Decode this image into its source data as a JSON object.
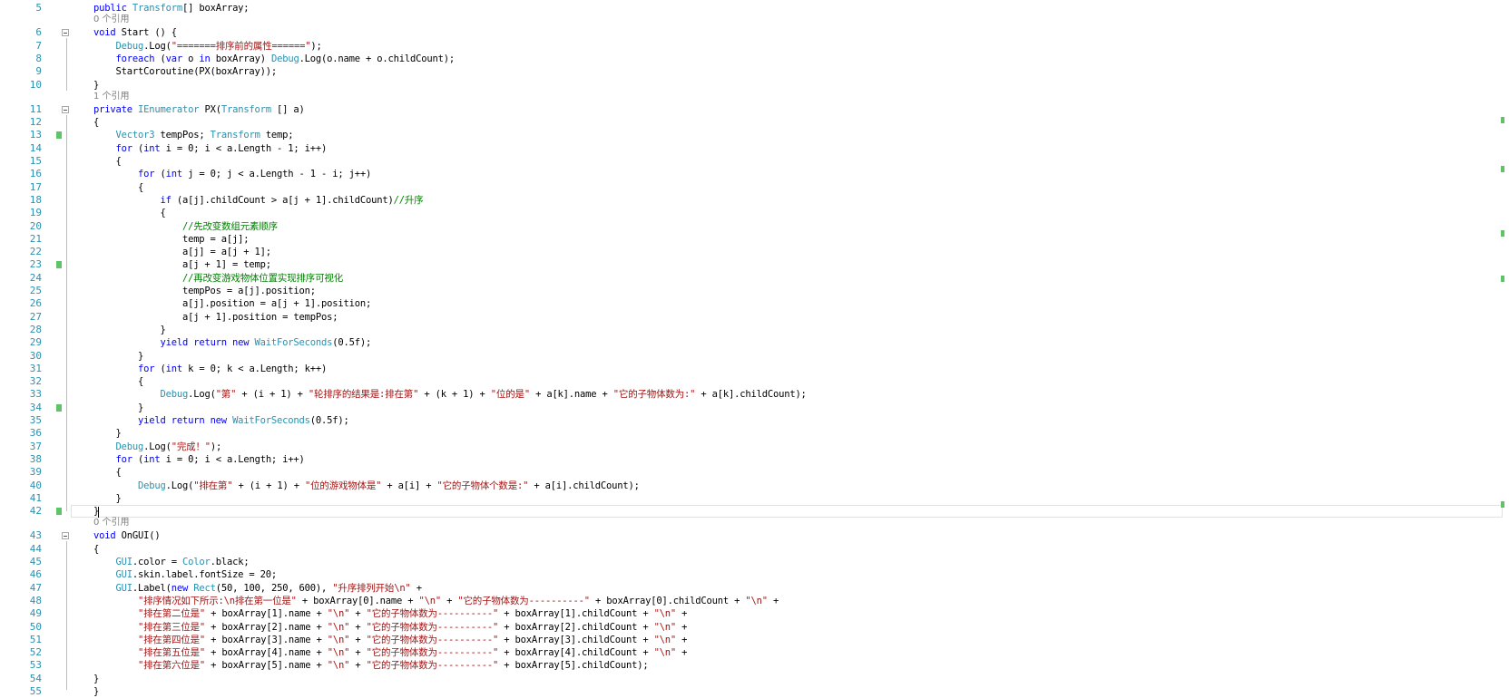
{
  "accent_colors": {
    "keyword": "#0000ff",
    "type": "#2b91af",
    "string": "#a31515",
    "comment": "#008000",
    "line_number": "#2b91af",
    "change_marker": "#5fc36a"
  },
  "lines": [
    {
      "n": "5",
      "tokens": [
        {
          "t": "public ",
          "c": "kw"
        },
        {
          "t": "Transform",
          "c": "ty"
        },
        {
          "t": "[] boxArray;",
          "c": ""
        }
      ]
    },
    {
      "n": "6",
      "hint": "0 个引用",
      "tokens": [
        {
          "t": "void ",
          "c": "kw"
        },
        {
          "t": "Start () {",
          "c": ""
        }
      ]
    },
    {
      "n": "7",
      "tokens": [
        {
          "t": "    ",
          "c": ""
        },
        {
          "t": "Debug",
          "c": "ty"
        },
        {
          "t": ".Log(",
          "c": ""
        },
        {
          "t": "\"=======排序前的属性======\"",
          "c": "st"
        },
        {
          "t": ");",
          "c": ""
        }
      ]
    },
    {
      "n": "8",
      "tokens": [
        {
          "t": "    ",
          "c": ""
        },
        {
          "t": "foreach ",
          "c": "kw"
        },
        {
          "t": "(",
          "c": ""
        },
        {
          "t": "var ",
          "c": "kw"
        },
        {
          "t": "o ",
          "c": ""
        },
        {
          "t": "in ",
          "c": "kw"
        },
        {
          "t": "boxArray) ",
          "c": ""
        },
        {
          "t": "Debug",
          "c": "ty"
        },
        {
          "t": ".Log(o.name + o.childCount);",
          "c": ""
        }
      ]
    },
    {
      "n": "9",
      "tokens": [
        {
          "t": "    StartCoroutine(PX(boxArray));",
          "c": ""
        }
      ]
    },
    {
      "n": "10",
      "tokens": [
        {
          "t": "}",
          "c": ""
        }
      ]
    },
    {
      "n": "11",
      "hint": "1 个引用",
      "tokens": [
        {
          "t": "private ",
          "c": "kw"
        },
        {
          "t": "IEnumerator ",
          "c": "ty"
        },
        {
          "t": "PX(",
          "c": ""
        },
        {
          "t": "Transform ",
          "c": "ty"
        },
        {
          "t": "[] a)",
          "c": ""
        }
      ]
    },
    {
      "n": "12",
      "tokens": [
        {
          "t": "{",
          "c": ""
        }
      ]
    },
    {
      "n": "13",
      "tokens": [
        {
          "t": "    ",
          "c": ""
        },
        {
          "t": "Vector3 ",
          "c": "ty"
        },
        {
          "t": "tempPos; ",
          "c": ""
        },
        {
          "t": "Transform ",
          "c": "ty"
        },
        {
          "t": "temp;",
          "c": ""
        }
      ]
    },
    {
      "n": "14",
      "tokens": [
        {
          "t": "    ",
          "c": ""
        },
        {
          "t": "for ",
          "c": "kw"
        },
        {
          "t": "(",
          "c": ""
        },
        {
          "t": "int ",
          "c": "kw"
        },
        {
          "t": "i = 0; i < a.Length - 1; i++)",
          "c": ""
        }
      ]
    },
    {
      "n": "15",
      "tokens": [
        {
          "t": "    {",
          "c": ""
        }
      ]
    },
    {
      "n": "16",
      "tokens": [
        {
          "t": "        ",
          "c": ""
        },
        {
          "t": "for ",
          "c": "kw"
        },
        {
          "t": "(",
          "c": ""
        },
        {
          "t": "int ",
          "c": "kw"
        },
        {
          "t": "j = 0; j < a.Length - 1 - i; j++)",
          "c": ""
        }
      ]
    },
    {
      "n": "17",
      "tokens": [
        {
          "t": "        {",
          "c": ""
        }
      ]
    },
    {
      "n": "18",
      "tokens": [
        {
          "t": "            ",
          "c": ""
        },
        {
          "t": "if ",
          "c": "kw"
        },
        {
          "t": "(a[j].childCount > a[j + 1].childCount)",
          "c": ""
        },
        {
          "t": "//升序",
          "c": "cm"
        }
      ]
    },
    {
      "n": "19",
      "tokens": [
        {
          "t": "            {",
          "c": ""
        }
      ]
    },
    {
      "n": "20",
      "tokens": [
        {
          "t": "                ",
          "c": ""
        },
        {
          "t": "//先改变数组元素顺序",
          "c": "cm"
        }
      ]
    },
    {
      "n": "21",
      "tokens": [
        {
          "t": "                temp = a[j];",
          "c": ""
        }
      ]
    },
    {
      "n": "22",
      "tokens": [
        {
          "t": "                a[j] = a[j + 1];",
          "c": ""
        }
      ]
    },
    {
      "n": "23",
      "tokens": [
        {
          "t": "                a[j + 1] = temp;",
          "c": ""
        }
      ]
    },
    {
      "n": "24",
      "tokens": [
        {
          "t": "                ",
          "c": ""
        },
        {
          "t": "//再改变游戏物体位置实现排序可视化",
          "c": "cm"
        }
      ]
    },
    {
      "n": "25",
      "tokens": [
        {
          "t": "                tempPos = a[j].position;",
          "c": ""
        }
      ]
    },
    {
      "n": "26",
      "tokens": [
        {
          "t": "                a[j].position = a[j + 1].position;",
          "c": ""
        }
      ]
    },
    {
      "n": "27",
      "tokens": [
        {
          "t": "                a[j + 1].position = tempPos;",
          "c": ""
        }
      ]
    },
    {
      "n": "28",
      "tokens": [
        {
          "t": "            }",
          "c": ""
        }
      ]
    },
    {
      "n": "29",
      "tokens": [
        {
          "t": "            ",
          "c": ""
        },
        {
          "t": "yield return new ",
          "c": "kw"
        },
        {
          "t": "WaitForSeconds",
          "c": "ty"
        },
        {
          "t": "(0.5f);",
          "c": ""
        }
      ]
    },
    {
      "n": "30",
      "tokens": [
        {
          "t": "        }",
          "c": ""
        }
      ]
    },
    {
      "n": "31",
      "tokens": [
        {
          "t": "        ",
          "c": ""
        },
        {
          "t": "for ",
          "c": "kw"
        },
        {
          "t": "(",
          "c": ""
        },
        {
          "t": "int ",
          "c": "kw"
        },
        {
          "t": "k = 0; k < a.Length; k++)",
          "c": ""
        }
      ]
    },
    {
      "n": "32",
      "tokens": [
        {
          "t": "        {",
          "c": ""
        }
      ]
    },
    {
      "n": "33",
      "tokens": [
        {
          "t": "            ",
          "c": ""
        },
        {
          "t": "Debug",
          "c": "ty"
        },
        {
          "t": ".Log(",
          "c": ""
        },
        {
          "t": "\"第\"",
          "c": "st"
        },
        {
          "t": " + (i + 1) + ",
          "c": ""
        },
        {
          "t": "\"轮排序的结果是:排在第\"",
          "c": "st"
        },
        {
          "t": " + (k + 1) + ",
          "c": ""
        },
        {
          "t": "\"位的是\"",
          "c": "st"
        },
        {
          "t": " + a[k].name + ",
          "c": ""
        },
        {
          "t": "\"它的子物体数为:\"",
          "c": "st"
        },
        {
          "t": " + a[k].childCount);",
          "c": ""
        }
      ]
    },
    {
      "n": "34",
      "tokens": [
        {
          "t": "        }",
          "c": ""
        }
      ]
    },
    {
      "n": "35",
      "tokens": [
        {
          "t": "        ",
          "c": ""
        },
        {
          "t": "yield return new ",
          "c": "kw"
        },
        {
          "t": "WaitForSeconds",
          "c": "ty"
        },
        {
          "t": "(0.5f);",
          "c": ""
        }
      ]
    },
    {
      "n": "36",
      "tokens": [
        {
          "t": "    }",
          "c": ""
        }
      ]
    },
    {
      "n": "37",
      "tokens": [
        {
          "t": "    ",
          "c": ""
        },
        {
          "t": "Debug",
          "c": "ty"
        },
        {
          "t": ".Log(",
          "c": ""
        },
        {
          "t": "\"完成！\"",
          "c": "st"
        },
        {
          "t": ");",
          "c": ""
        }
      ]
    },
    {
      "n": "38",
      "tokens": [
        {
          "t": "    ",
          "c": ""
        },
        {
          "t": "for ",
          "c": "kw"
        },
        {
          "t": "(",
          "c": ""
        },
        {
          "t": "int ",
          "c": "kw"
        },
        {
          "t": "i = 0; i < a.Length; i++)",
          "c": ""
        }
      ]
    },
    {
      "n": "39",
      "tokens": [
        {
          "t": "    {",
          "c": ""
        }
      ]
    },
    {
      "n": "40",
      "tokens": [
        {
          "t": "        ",
          "c": ""
        },
        {
          "t": "Debug",
          "c": "ty"
        },
        {
          "t": ".Log(",
          "c": ""
        },
        {
          "t": "\"排在第\"",
          "c": "st"
        },
        {
          "t": " + (i + 1) + ",
          "c": ""
        },
        {
          "t": "\"位的游戏物体是\"",
          "c": "st"
        },
        {
          "t": " + a[i] + ",
          "c": ""
        },
        {
          "t": "\"它的子物体个数是:\"",
          "c": "st"
        },
        {
          "t": " + a[i].childCount);",
          "c": ""
        }
      ]
    },
    {
      "n": "41",
      "tokens": [
        {
          "t": "    }",
          "c": ""
        }
      ]
    },
    {
      "n": "42",
      "tokens": [
        {
          "t": "}",
          "c": ""
        }
      ]
    },
    {
      "n": "43",
      "hint": "0 个引用",
      "tokens": [
        {
          "t": "void ",
          "c": "kw"
        },
        {
          "t": "OnGUI()",
          "c": ""
        }
      ]
    },
    {
      "n": "44",
      "tokens": [
        {
          "t": "{",
          "c": ""
        }
      ]
    },
    {
      "n": "45",
      "tokens": [
        {
          "t": "    ",
          "c": ""
        },
        {
          "t": "GUI",
          "c": "ty"
        },
        {
          "t": ".color = ",
          "c": ""
        },
        {
          "t": "Color",
          "c": "ty"
        },
        {
          "t": ".black;",
          "c": ""
        }
      ]
    },
    {
      "n": "46",
      "tokens": [
        {
          "t": "    ",
          "c": ""
        },
        {
          "t": "GUI",
          "c": "ty"
        },
        {
          "t": ".skin.label.fontSize = 20;",
          "c": ""
        }
      ]
    },
    {
      "n": "47",
      "tokens": [
        {
          "t": "    ",
          "c": ""
        },
        {
          "t": "GUI",
          "c": "ty"
        },
        {
          "t": ".Label(",
          "c": ""
        },
        {
          "t": "new ",
          "c": "kw"
        },
        {
          "t": "Rect",
          "c": "ty"
        },
        {
          "t": "(50, 100, 250, 600), ",
          "c": ""
        },
        {
          "t": "\"升序排列开始\\n\"",
          "c": "st"
        },
        {
          "t": " +",
          "c": ""
        }
      ]
    },
    {
      "n": "48",
      "tokens": [
        {
          "t": "        ",
          "c": ""
        },
        {
          "t": "\"排序情况如下所示:\\n排在第一位是\"",
          "c": "st"
        },
        {
          "t": " + boxArray[0].name + ",
          "c": ""
        },
        {
          "t": "\"\\n\"",
          "c": "st"
        },
        {
          "t": " + ",
          "c": ""
        },
        {
          "t": "\"它的子物体数为----------\"",
          "c": "st"
        },
        {
          "t": " + boxArray[0].childCount + ",
          "c": ""
        },
        {
          "t": "\"\\n\"",
          "c": "st"
        },
        {
          "t": " +",
          "c": ""
        }
      ]
    },
    {
      "n": "49",
      "tokens": [
        {
          "t": "        ",
          "c": ""
        },
        {
          "t": "\"排在第二位是\"",
          "c": "st"
        },
        {
          "t": " + boxArray[1].name + ",
          "c": ""
        },
        {
          "t": "\"\\n\"",
          "c": "st"
        },
        {
          "t": " + ",
          "c": ""
        },
        {
          "t": "\"它的子物体数为----------\"",
          "c": "st"
        },
        {
          "t": " + boxArray[1].childCount + ",
          "c": ""
        },
        {
          "t": "\"\\n\"",
          "c": "st"
        },
        {
          "t": " +",
          "c": ""
        }
      ]
    },
    {
      "n": "50",
      "tokens": [
        {
          "t": "        ",
          "c": ""
        },
        {
          "t": "\"排在第三位是\"",
          "c": "st"
        },
        {
          "t": " + boxArray[2].name + ",
          "c": ""
        },
        {
          "t": "\"\\n\"",
          "c": "st"
        },
        {
          "t": " + ",
          "c": ""
        },
        {
          "t": "\"它的子物体数为----------\"",
          "c": "st"
        },
        {
          "t": " + boxArray[2].childCount + ",
          "c": ""
        },
        {
          "t": "\"\\n\"",
          "c": "st"
        },
        {
          "t": " +",
          "c": ""
        }
      ]
    },
    {
      "n": "51",
      "tokens": [
        {
          "t": "        ",
          "c": ""
        },
        {
          "t": "\"排在第四位是\"",
          "c": "st"
        },
        {
          "t": " + boxArray[3].name + ",
          "c": ""
        },
        {
          "t": "\"\\n\"",
          "c": "st"
        },
        {
          "t": " + ",
          "c": ""
        },
        {
          "t": "\"它的子物体数为----------\"",
          "c": "st"
        },
        {
          "t": " + boxArray[3].childCount + ",
          "c": ""
        },
        {
          "t": "\"\\n\"",
          "c": "st"
        },
        {
          "t": " +",
          "c": ""
        }
      ]
    },
    {
      "n": "52",
      "tokens": [
        {
          "t": "        ",
          "c": ""
        },
        {
          "t": "\"排在第五位是\"",
          "c": "st"
        },
        {
          "t": " + boxArray[4].name + ",
          "c": ""
        },
        {
          "t": "\"\\n\"",
          "c": "st"
        },
        {
          "t": " + ",
          "c": ""
        },
        {
          "t": "\"它的子物体数为----------\"",
          "c": "st"
        },
        {
          "t": " + boxArray[4].childCount + ",
          "c": ""
        },
        {
          "t": "\"\\n\"",
          "c": "st"
        },
        {
          "t": " +",
          "c": ""
        }
      ]
    },
    {
      "n": "53",
      "tokens": [
        {
          "t": "        ",
          "c": ""
        },
        {
          "t": "\"排在第六位是\"",
          "c": "st"
        },
        {
          "t": " + boxArray[5].name + ",
          "c": ""
        },
        {
          "t": "\"\\n\"",
          "c": "st"
        },
        {
          "t": " + ",
          "c": ""
        },
        {
          "t": "\"它的子物体数为----------\"",
          "c": "st"
        },
        {
          "t": " + boxArray[5].childCount);",
          "c": ""
        }
      ]
    },
    {
      "n": "54",
      "tokens": [
        {
          "t": "}",
          "c": ""
        }
      ]
    },
    {
      "n": "55",
      "tokens": [
        {
          "t": "}",
          "c": ""
        }
      ]
    }
  ]
}
